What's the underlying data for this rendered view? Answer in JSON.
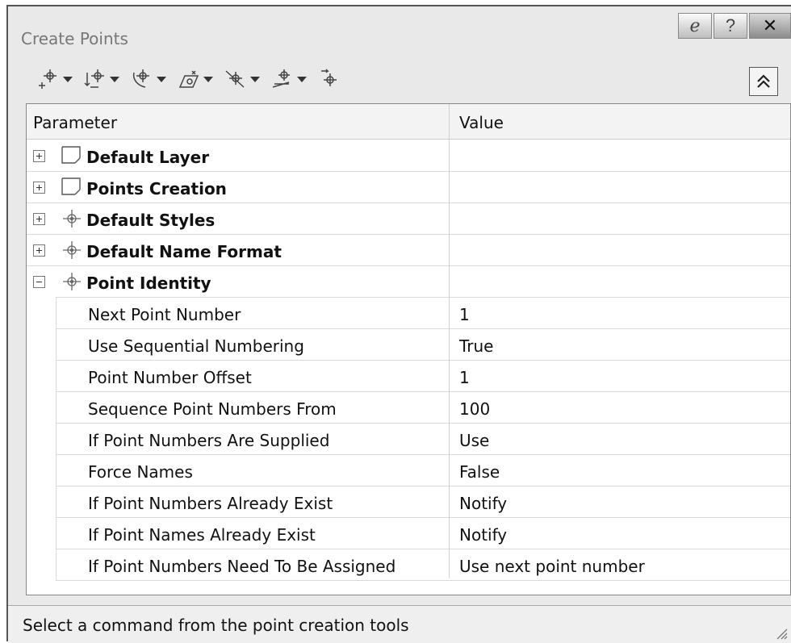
{
  "window": {
    "title": "Create Points"
  },
  "caption": {
    "pin_label": "ℯ",
    "help_label": "?",
    "close_label": "✕"
  },
  "toolbar": {
    "tools": [
      {
        "icon": "miscellaneous-point-icon"
      },
      {
        "icon": "intersection-point-icon"
      },
      {
        "icon": "alignment-point-icon"
      },
      {
        "icon": "surface-point-icon"
      },
      {
        "icon": "interpolate-point-icon"
      },
      {
        "icon": "slope-point-icon"
      },
      {
        "icon": "convert-point-icon"
      }
    ]
  },
  "grid": {
    "header_parameter": "Parameter",
    "header_value": "Value",
    "groups": [
      {
        "label": "Default Layer",
        "expanded": false,
        "icon": "layer-icon"
      },
      {
        "label": "Points Creation",
        "expanded": false,
        "icon": "layer-icon"
      },
      {
        "label": "Default Styles",
        "expanded": false,
        "icon": "point-marker-icon"
      },
      {
        "label": "Default Name Format",
        "expanded": false,
        "icon": "point-marker-icon"
      },
      {
        "label": "Point Identity",
        "expanded": true,
        "icon": "point-marker-icon"
      }
    ],
    "rows": [
      {
        "label": "Next Point Number",
        "value": "1"
      },
      {
        "label": "Use Sequential Numbering",
        "value": "True"
      },
      {
        "label": "Point Number Offset",
        "value": "1"
      },
      {
        "label": "Sequence Point Numbers From",
        "value": "100"
      },
      {
        "label": "If Point Numbers Are Supplied",
        "value": "Use"
      },
      {
        "label": "Force Names",
        "value": "False"
      },
      {
        "label": "If Point Numbers Already Exist",
        "value": "Notify"
      },
      {
        "label": "If Point Names Already Exist",
        "value": "Notify"
      },
      {
        "label": "If Point Numbers Need To Be Assigned",
        "value": "Use next point number"
      }
    ]
  },
  "status": {
    "text": "Select a command from the point creation tools"
  }
}
